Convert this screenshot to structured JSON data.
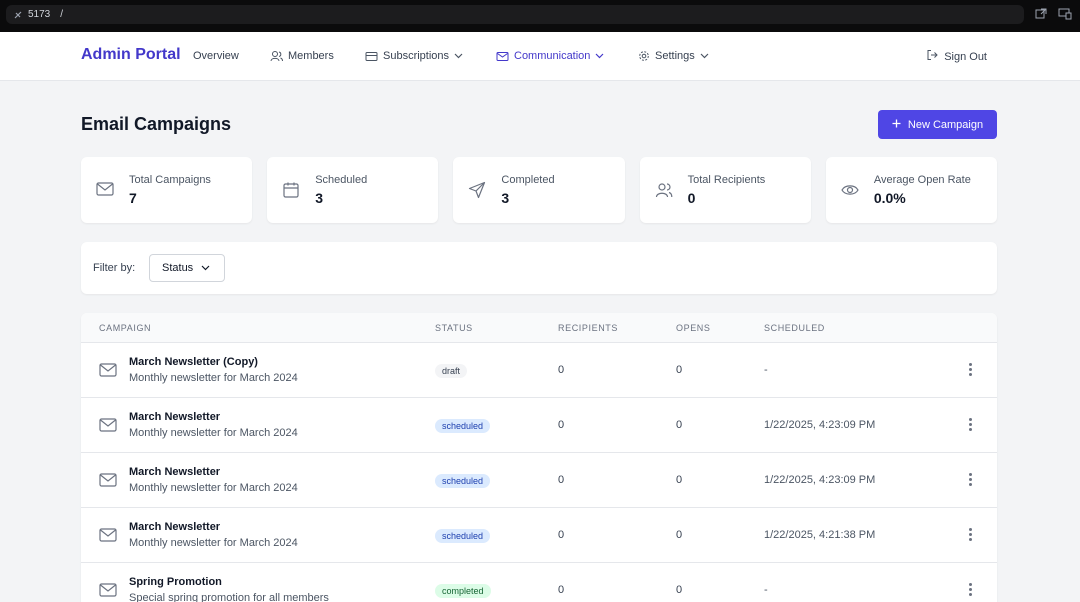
{
  "browser": {
    "port": "5173",
    "path": "/"
  },
  "nav": {
    "brand": "Admin Portal",
    "items": [
      {
        "label": "Overview",
        "icon": "none"
      },
      {
        "label": "Members",
        "icon": "users-icon"
      },
      {
        "label": "Subscriptions",
        "icon": "card-icon",
        "dropdown": true
      },
      {
        "label": "Communication",
        "icon": "mail-icon",
        "dropdown": true,
        "active": true
      },
      {
        "label": "Settings",
        "icon": "gear-icon",
        "dropdown": true
      }
    ],
    "sign_out": "Sign Out"
  },
  "page": {
    "title": "Email Campaigns",
    "new_button": "New Campaign"
  },
  "stats": [
    {
      "label": "Total Campaigns",
      "value": "7",
      "icon": "mail-icon"
    },
    {
      "label": "Scheduled",
      "value": "3",
      "icon": "calendar-icon"
    },
    {
      "label": "Completed",
      "value": "3",
      "icon": "send-icon"
    },
    {
      "label": "Total Recipients",
      "value": "0",
      "icon": "users-icon"
    },
    {
      "label": "Average Open Rate",
      "value": "0.0%",
      "icon": "eye-icon"
    }
  ],
  "filter": {
    "label": "Filter by:",
    "status": "Status"
  },
  "table": {
    "headers": [
      "CAMPAIGN",
      "STATUS",
      "RECIPIENTS",
      "OPENS",
      "SCHEDULED"
    ],
    "rows": [
      {
        "name": "March Newsletter (Copy)",
        "desc": "Monthly newsletter for March 2024",
        "status": "draft",
        "recipients": "0",
        "opens": "0",
        "scheduled": "-"
      },
      {
        "name": "March Newsletter",
        "desc": "Monthly newsletter for March 2024",
        "status": "scheduled",
        "recipients": "0",
        "opens": "0",
        "scheduled": "1/22/2025, 4:23:09 PM"
      },
      {
        "name": "March Newsletter",
        "desc": "Monthly newsletter for March 2024",
        "status": "scheduled",
        "recipients": "0",
        "opens": "0",
        "scheduled": "1/22/2025, 4:23:09 PM"
      },
      {
        "name": "March Newsletter",
        "desc": "Monthly newsletter for March 2024",
        "status": "scheduled",
        "recipients": "0",
        "opens": "0",
        "scheduled": "1/22/2025, 4:21:38 PM"
      },
      {
        "name": "Spring Promotion",
        "desc": "Special spring promotion for all members",
        "status": "completed",
        "recipients": "0",
        "opens": "0",
        "scheduled": "-"
      }
    ]
  },
  "colors": {
    "accent": "#4f46e5",
    "brand": "#4338ca"
  }
}
